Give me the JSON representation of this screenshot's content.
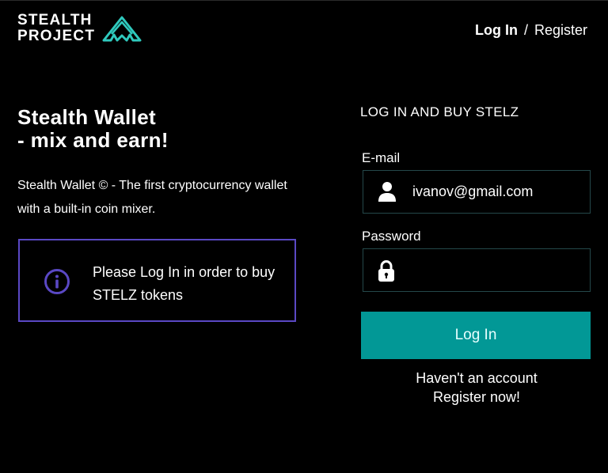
{
  "header": {
    "logo_line1": "STEALTH",
    "logo_line2": "PROJECT",
    "login_label": "Log In",
    "separator": "/",
    "register_label": "Register"
  },
  "hero": {
    "title_line1": "Stealth Wallet",
    "title_line2": "- mix and earn!",
    "description": "Stealth Wallet © - The first cryptocurrency wallet with a built-in coin mixer."
  },
  "notice": {
    "icon": "info-icon",
    "text": "Please Log In in order to buy STELZ tokens"
  },
  "form": {
    "heading": "LOG IN AND BUY STELZ",
    "email_label": "E-mail",
    "email_value": "ivanov@gmail.com",
    "email_icon": "user-icon",
    "password_label": "Password",
    "password_value": "",
    "password_icon": "lock-icon",
    "submit_label": "Log In",
    "signup_line1": "Haven't an account",
    "signup_line2": "Register now!"
  },
  "colors": {
    "background": "#000000",
    "accent": "#029896",
    "logo_mark": "#2fc9bd",
    "notice_border": "#5a48c4",
    "field_border": "#24484a"
  }
}
